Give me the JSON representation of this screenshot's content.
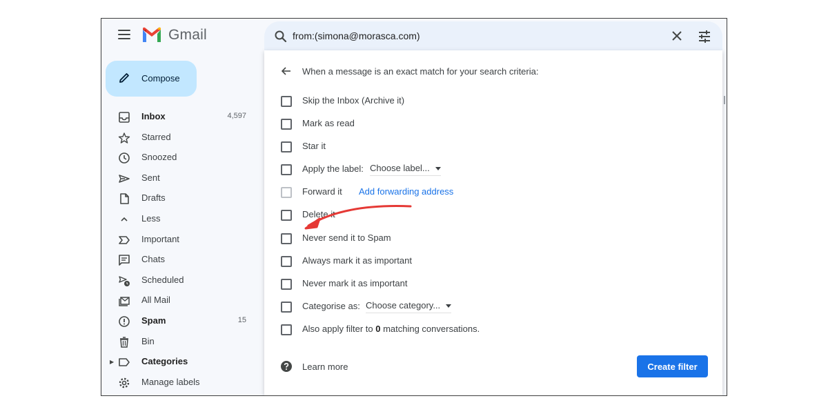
{
  "header": {
    "brand": "Gmail",
    "search_query": "from:(simona@morasca.com)"
  },
  "sidebar": {
    "compose_label": "Compose",
    "items": [
      {
        "label": "Inbox",
        "count": "4,597",
        "icon": "inbox-icon",
        "bold": true
      },
      {
        "label": "Starred",
        "count": "",
        "icon": "star-icon",
        "bold": false
      },
      {
        "label": "Snoozed",
        "count": "",
        "icon": "clock-icon",
        "bold": false
      },
      {
        "label": "Sent",
        "count": "",
        "icon": "send-icon",
        "bold": false
      },
      {
        "label": "Drafts",
        "count": "",
        "icon": "draft-icon",
        "bold": false
      },
      {
        "label": "Less",
        "count": "",
        "icon": "chevron-up-icon",
        "bold": false
      },
      {
        "label": "Important",
        "count": "",
        "icon": "important-icon",
        "bold": false
      },
      {
        "label": "Chats",
        "count": "",
        "icon": "chat-icon",
        "bold": false
      },
      {
        "label": "Scheduled",
        "count": "",
        "icon": "scheduled-send-icon",
        "bold": false
      },
      {
        "label": "All Mail",
        "count": "",
        "icon": "all-mail-icon",
        "bold": false
      },
      {
        "label": "Spam",
        "count": "15",
        "icon": "spam-icon",
        "bold": true
      },
      {
        "label": "Bin",
        "count": "",
        "icon": "trash-icon",
        "bold": false
      },
      {
        "label": "Categories",
        "count": "",
        "icon": "label-icon",
        "bold": true
      },
      {
        "label": "Manage labels",
        "count": "",
        "icon": "gear-icon",
        "bold": false
      }
    ]
  },
  "filter": {
    "title": "When a message is an exact match for your search criteria:",
    "options": {
      "skip_inbox": "Skip the Inbox (Archive it)",
      "mark_read": "Mark as read",
      "star_it": "Star it",
      "apply_label": "Apply the label:",
      "apply_label_select": "Choose label...",
      "forward_it": "Forward it",
      "add_forwarding": "Add forwarding address",
      "delete_it": "Delete it",
      "never_spam": "Never send it to Spam",
      "always_important": "Always mark it as important",
      "never_important": "Never mark it as important",
      "categorise": "Categorise as:",
      "categorise_select": "Choose category...",
      "also_apply_prefix": "Also apply filter to ",
      "also_apply_count": "0",
      "also_apply_suffix": " matching conversations."
    },
    "learn_more": "Learn more",
    "create_button": "Create filter"
  },
  "colors": {
    "accent": "#1a73e8",
    "compose_bg": "#c2e7ff",
    "search_bg": "#eaf1fb",
    "annotation_arrow": "#e53935"
  }
}
